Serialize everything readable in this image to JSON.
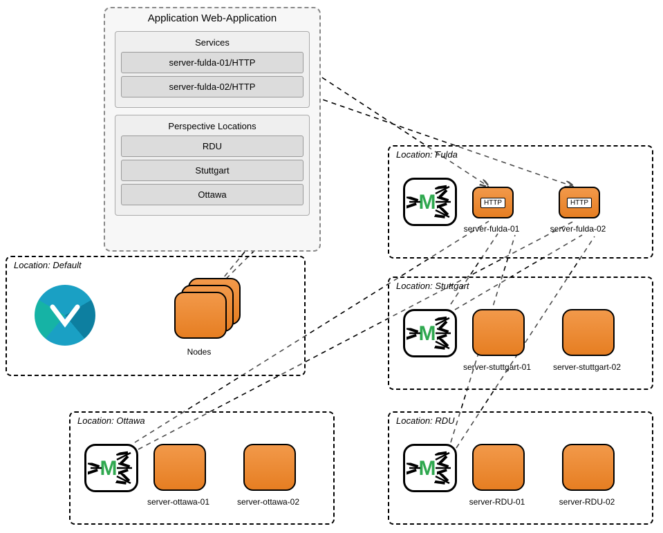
{
  "config": {
    "title": "Application Web-Application",
    "services_title": "Services",
    "services": [
      "server-fulda-01/HTTP",
      "server-fulda-02/HTTP"
    ],
    "perspective_title": "Perspective Locations",
    "perspectives": [
      "RDU",
      "Stuttgart",
      "Ottawa"
    ]
  },
  "locations": {
    "default": {
      "title": "Location: Default",
      "nodes_label": "Nodes"
    },
    "fulda": {
      "title": "Location: Fulda",
      "http_badge": "HTTP",
      "servers": [
        "server-fulda-01",
        "server-fulda-02"
      ]
    },
    "stuttgart": {
      "title": "Location: Stuttgart",
      "servers": [
        "server-stuttgart-01",
        "server-stuttgart-02"
      ]
    },
    "rdu": {
      "title": "Location: RDU",
      "servers": [
        "server-RDU-01",
        "server-RDU-02"
      ]
    },
    "ottawa": {
      "title": "Location: Ottawa",
      "servers": [
        "server-ottawa-01",
        "server-ottawa-02"
      ]
    }
  },
  "minion_glyph": "M"
}
